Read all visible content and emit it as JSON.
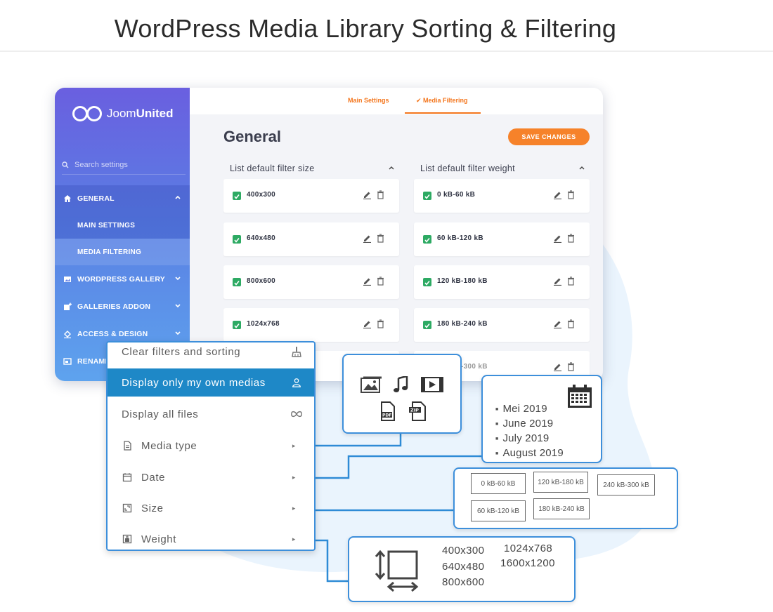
{
  "page": {
    "title": "WordPress Media Library Sorting & Filtering"
  },
  "colors": {
    "accent_orange": "#f6822a",
    "menu_active": "#1e88c7",
    "border_blue": "#3d8fdb",
    "check_green": "#2daa63",
    "blob": "#e8f4fd"
  },
  "app": {
    "logo": {
      "part1": "Joom",
      "part2": "United"
    },
    "search_placeholder": "Search settings",
    "sidebar": {
      "general": "GENERAL",
      "main_settings": "MAIN SETTINGS",
      "media_filtering": "MEDIA FILTERING",
      "items": [
        {
          "label": "WORDPRESS GALLERY",
          "icon": "image-icon"
        },
        {
          "label": "GALLERIES ADDON",
          "icon": "gallery-add-icon"
        },
        {
          "label": "ACCESS & DESIGN",
          "icon": "paint-bucket-icon"
        },
        {
          "label": "RENAME",
          "icon": "rename-icon"
        }
      ]
    },
    "tabs": {
      "main_settings": "Main Settings",
      "media_filtering": "Media Filtering"
    },
    "section_title": "General",
    "save_button": "SAVE CHANGES",
    "size_column": {
      "header": "List default filter size",
      "items": [
        "400x300",
        "640x480",
        "800x600",
        "1024x768"
      ]
    },
    "weight_column": {
      "header": "List default filter weight",
      "items": [
        "0 kB-60 kB",
        "60 kB-120 kB",
        "120 kB-180 kB",
        "180 kB-240 kB",
        "240 kB-300 kB"
      ]
    }
  },
  "menu": {
    "clear": "Clear filters and sorting",
    "own_medias": "Display only my own medias",
    "all_files": "Display all files",
    "media_type": "Media type",
    "date": "Date",
    "size": "Size",
    "weight": "Weight"
  },
  "callouts": {
    "media_types": [
      "image-icon",
      "music-note-icon",
      "video-icon",
      "pdf-icon",
      "zip-icon"
    ],
    "dates": [
      "Mei 2019",
      "June 2019",
      "July 2019",
      "August 2019"
    ],
    "weights": [
      "0 kB-60 kB",
      "120 kB-180 kB",
      "240 kB-300 kB",
      "60 kB-120 kB",
      "180 kB-240 kB"
    ],
    "sizes": [
      "400x300",
      "640x480",
      "800x600",
      "1024x768",
      "1600x1200"
    ]
  }
}
